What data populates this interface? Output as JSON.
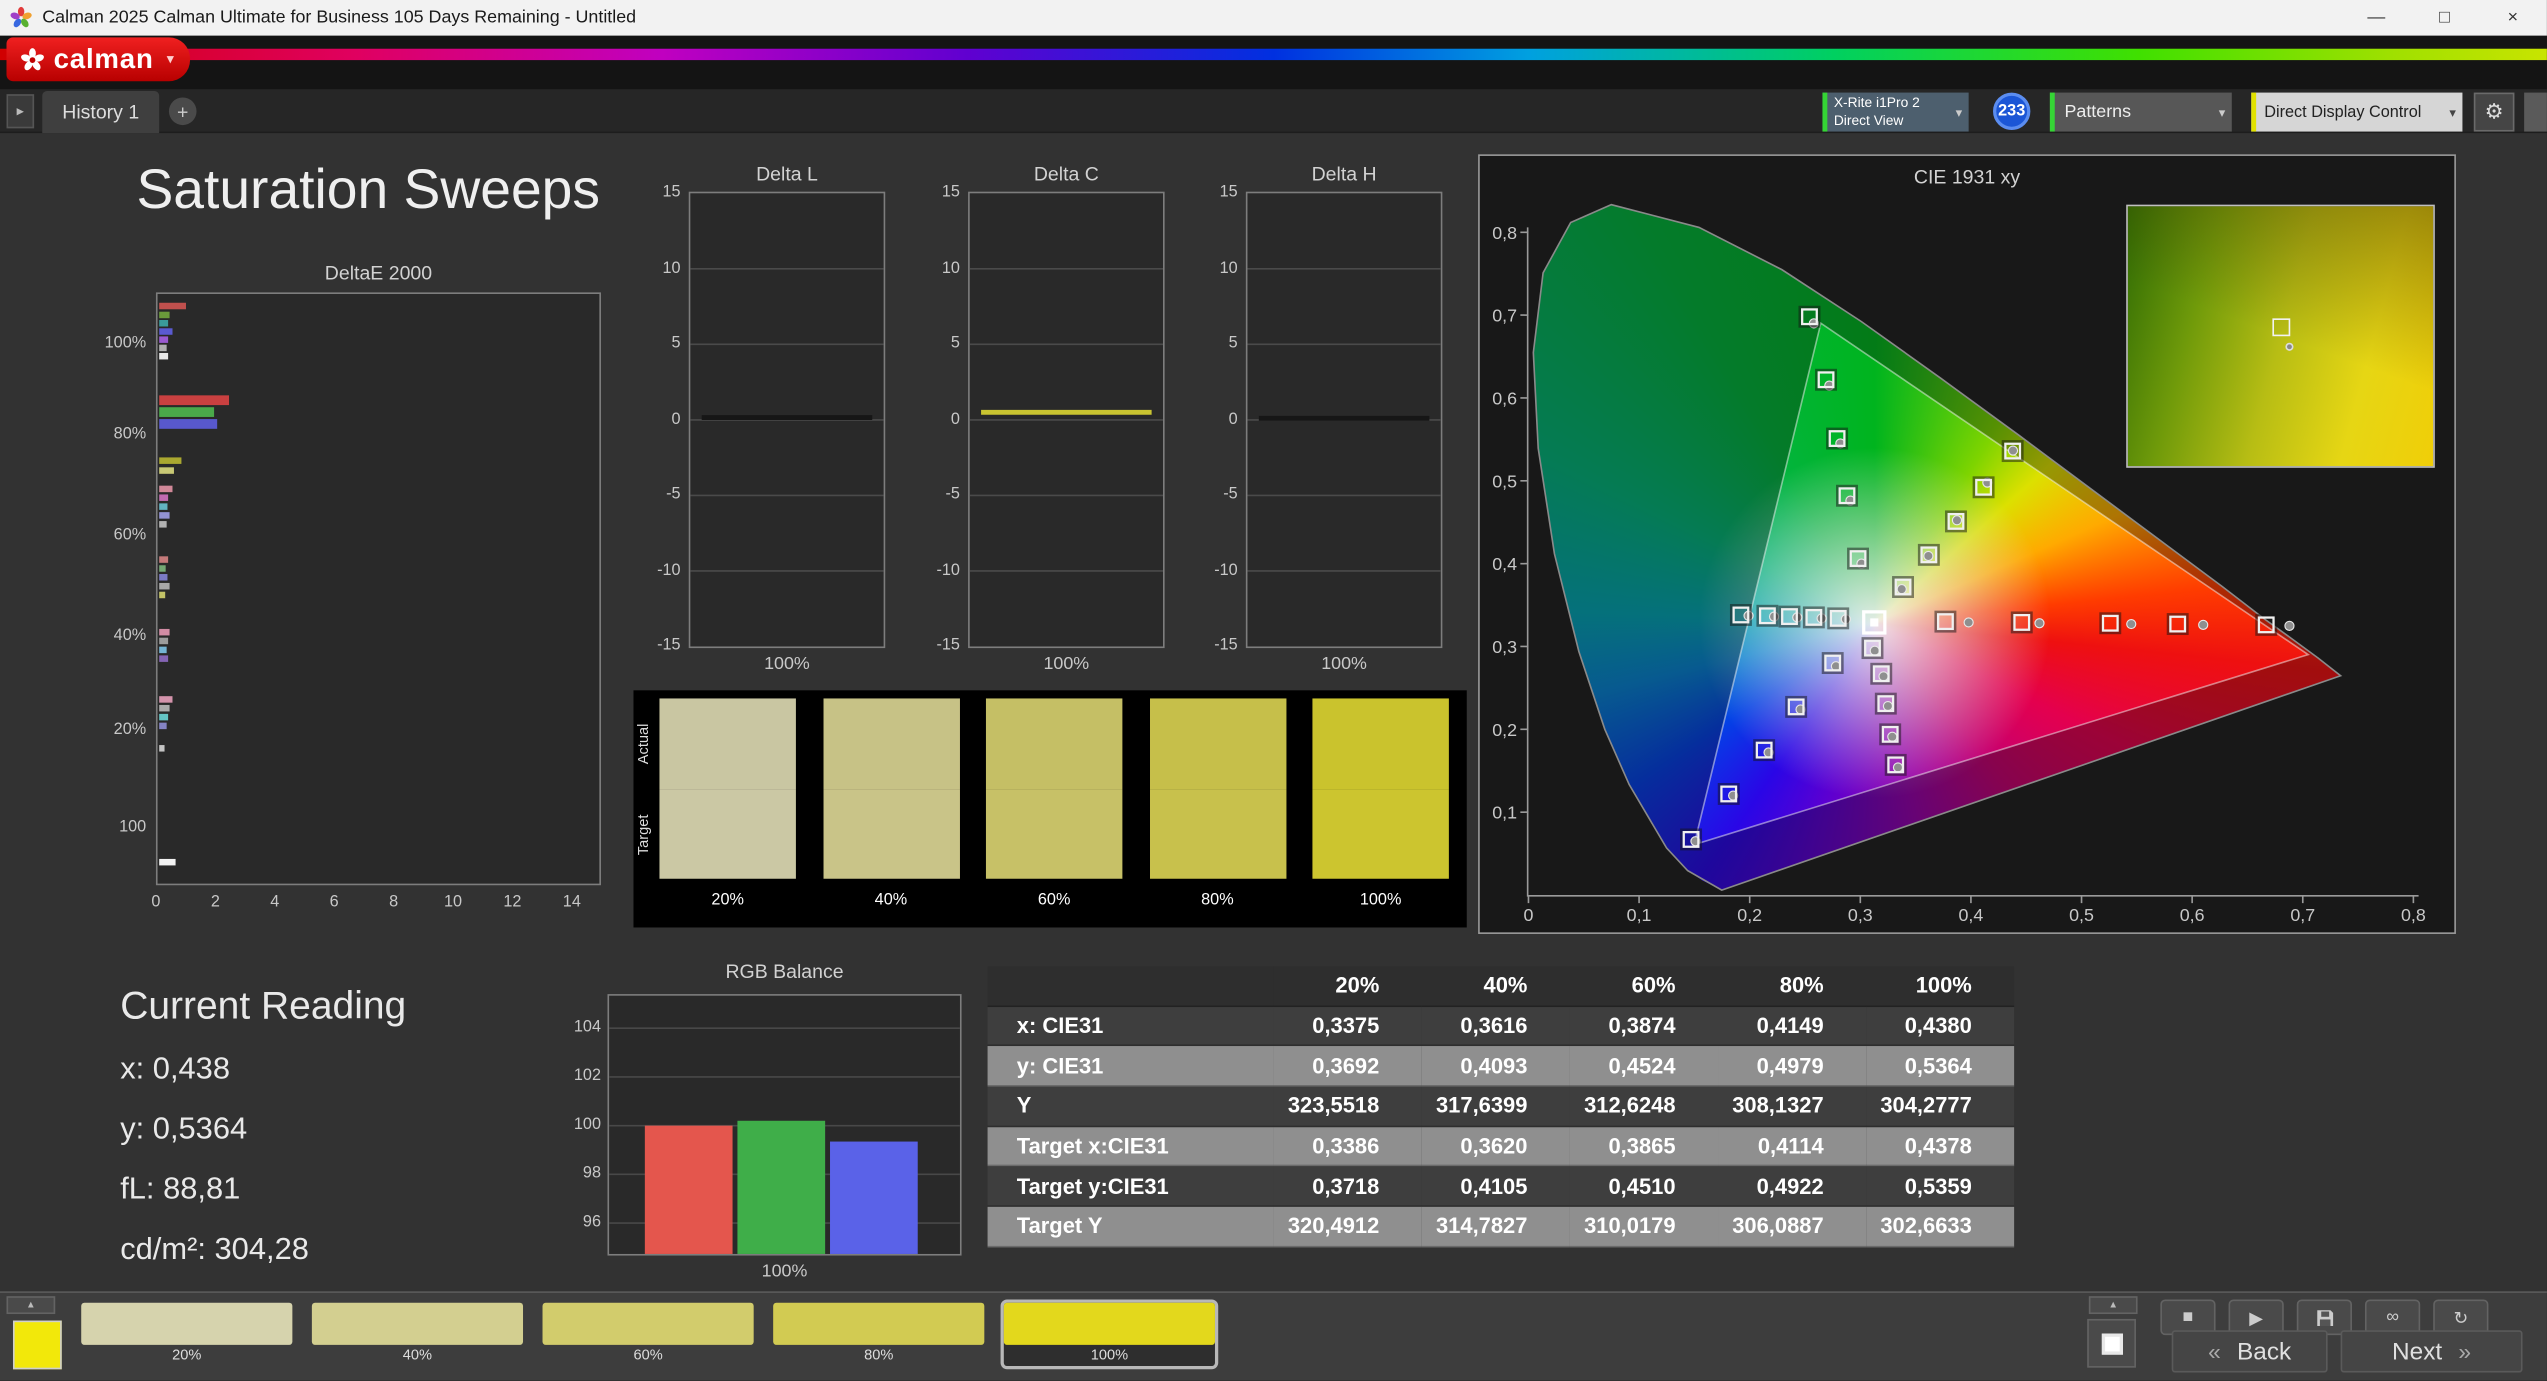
{
  "window": {
    "title": "Calman 2025 Calman Ultimate for Business 105 Days Remaining  - Untitled",
    "controls": {
      "minimize": "—",
      "maximize": "□",
      "close": "×"
    }
  },
  "logo": {
    "text": "calman"
  },
  "icons": {
    "chevron_down": "▾",
    "gear": "⚙",
    "pane_toggle": "▸",
    "up_triangle": "▲"
  },
  "tabbar": {
    "history_tab": "History 1",
    "add_tab": "+"
  },
  "toolbar": {
    "meter": {
      "line1": "X-Rite i1Pro 2",
      "line2": "Direct View"
    },
    "badge": "233",
    "patterns": "Patterns",
    "display_control": "Direct Display Control"
  },
  "page": {
    "title": "Saturation Sweeps"
  },
  "current_reading": {
    "title": "Current Reading",
    "x": "x: 0,438",
    "y": "y: 0,5364",
    "fl": "fL: 88,81",
    "cdm2": "cd/m²: 304,28"
  },
  "table": {
    "columns": [
      "20%",
      "40%",
      "60%",
      "80%",
      "100%"
    ],
    "rows": [
      {
        "label": "x: CIE31",
        "values": [
          "0,3375",
          "0,3616",
          "0,3874",
          "0,4149",
          "0,4380"
        ]
      },
      {
        "label": "y: CIE31",
        "values": [
          "0,3692",
          "0,4093",
          "0,4524",
          "0,4979",
          "0,5364"
        ]
      },
      {
        "label": "Y",
        "values": [
          "323,5518",
          "317,6399",
          "312,6248",
          "308,1327",
          "304,2777"
        ]
      },
      {
        "label": "Target x:CIE31",
        "values": [
          "0,3386",
          "0,3620",
          "0,3865",
          "0,4114",
          "0,4378"
        ]
      },
      {
        "label": "Target y:CIE31",
        "values": [
          "0,3718",
          "0,4105",
          "0,4510",
          "0,4922",
          "0,5359"
        ]
      },
      {
        "label": "Target Y",
        "values": [
          "320,4912",
          "314,7827",
          "310,0179",
          "306,0887",
          "302,6633"
        ]
      }
    ]
  },
  "swatch_strip": {
    "row_labels": [
      "Actual",
      "Target"
    ],
    "swatches": [
      {
        "label": "20%",
        "actual": "#c9c6a2",
        "target": "#cbc8a4"
      },
      {
        "label": "40%",
        "actual": "#c7c286",
        "target": "#c9c488"
      },
      {
        "label": "60%",
        "actual": "#c5bf65",
        "target": "#c7c167"
      },
      {
        "label": "80%",
        "actual": "#c6bf4a",
        "target": "#c8c14c"
      },
      {
        "label": "100%",
        "actual": "#cac32d",
        "target": "#ccc52f"
      }
    ]
  },
  "bottombar": {
    "swatches": [
      {
        "label": "20%",
        "color": "#d6d3ad",
        "selected": false
      },
      {
        "label": "40%",
        "color": "#d3cf90",
        "selected": false
      },
      {
        "label": "60%",
        "color": "#d2cc6c",
        "selected": false
      },
      {
        "label": "80%",
        "color": "#d2cb52",
        "selected": false
      },
      {
        "label": "100%",
        "color": "#e3d81c",
        "selected": true
      }
    ],
    "back": "Back",
    "next": "Next",
    "back_chevron": "«",
    "next_chevron": "»",
    "icons": {
      "stop": "■",
      "play": "▶",
      "infinity": "∞",
      "refresh": "↻"
    }
  },
  "chart_data": [
    {
      "id": "deltae",
      "type": "bar",
      "orientation": "horizontal",
      "title": "DeltaE 2000",
      "xlim": [
        0,
        14
      ],
      "x_ticks": [
        0,
        2,
        4,
        6,
        8,
        10,
        12,
        14
      ],
      "y_labels": [
        {
          "text": "100%",
          "frac": 0.085
        },
        {
          "text": "80%",
          "frac": 0.241
        },
        {
          "text": "60%",
          "frac": 0.411
        },
        {
          "text": "40%",
          "frac": 0.581
        },
        {
          "text": "20%",
          "frac": 0.74
        },
        {
          "text": "100",
          "frac": 0.907
        }
      ],
      "bars": [
        {
          "frac": 0.015,
          "value": 0.9,
          "color": "#c0504d"
        },
        {
          "frac": 0.03,
          "value": 0.35,
          "color": "#6a9a3a"
        },
        {
          "frac": 0.044,
          "value": 0.3,
          "color": "#3a9a9a"
        },
        {
          "frac": 0.058,
          "value": 0.45,
          "color": "#5a5ad0"
        },
        {
          "frac": 0.072,
          "value": 0.3,
          "color": "#9a5ad0"
        },
        {
          "frac": 0.086,
          "value": 0.25,
          "color": "#b0b0b0"
        },
        {
          "frac": 0.1,
          "value": 0.3,
          "color": "#e8e8e8"
        },
        {
          "frac": 0.172,
          "value": 2.35,
          "color": "#c94040",
          "thick": true
        },
        {
          "frac": 0.192,
          "value": 1.85,
          "color": "#4aa84a",
          "thick": true
        },
        {
          "frac": 0.212,
          "value": 1.95,
          "color": "#5858cc",
          "thick": true
        },
        {
          "frac": 0.277,
          "value": 0.75,
          "color": "#aaa830"
        },
        {
          "frac": 0.294,
          "value": 0.5,
          "color": "#c8c874"
        },
        {
          "frac": 0.325,
          "value": 0.45,
          "color": "#d08898"
        },
        {
          "frac": 0.34,
          "value": 0.3,
          "color": "#c06ab0"
        },
        {
          "frac": 0.355,
          "value": 0.28,
          "color": "#62b2c2"
        },
        {
          "frac": 0.37,
          "value": 0.35,
          "color": "#9292d2"
        },
        {
          "frac": 0.385,
          "value": 0.25,
          "color": "#b2b2b2"
        },
        {
          "frac": 0.445,
          "value": 0.3,
          "color": "#c47a7a"
        },
        {
          "frac": 0.46,
          "value": 0.22,
          "color": "#74a874"
        },
        {
          "frac": 0.475,
          "value": 0.28,
          "color": "#7a7ac4"
        },
        {
          "frac": 0.49,
          "value": 0.35,
          "color": "#a8a8a8"
        },
        {
          "frac": 0.505,
          "value": 0.2,
          "color": "#c2c266"
        },
        {
          "frac": 0.568,
          "value": 0.35,
          "color": "#d28ca4"
        },
        {
          "frac": 0.583,
          "value": 0.3,
          "color": "#9c9c9c"
        },
        {
          "frac": 0.598,
          "value": 0.25,
          "color": "#74b4d4"
        },
        {
          "frac": 0.613,
          "value": 0.3,
          "color": "#8464b4"
        },
        {
          "frac": 0.682,
          "value": 0.45,
          "color": "#d494ac"
        },
        {
          "frac": 0.697,
          "value": 0.35,
          "color": "#ababab"
        },
        {
          "frac": 0.712,
          "value": 0.3,
          "color": "#64c4c4"
        },
        {
          "frac": 0.727,
          "value": 0.25,
          "color": "#8484c4"
        },
        {
          "frac": 0.765,
          "value": 0.18,
          "color": "#c4c4c4"
        },
        {
          "frac": 0.958,
          "value": 0.55,
          "color": "#f2f2f2"
        }
      ]
    },
    {
      "id": "delta-l",
      "type": "line",
      "title": "Delta L",
      "ylim": [
        -15,
        15
      ],
      "y_ticks": [
        15,
        10,
        5,
        0,
        -5,
        -10,
        -15
      ],
      "x_label": "100%",
      "value": 0.15,
      "line_color": "#161616"
    },
    {
      "id": "delta-c",
      "type": "line",
      "title": "Delta C",
      "ylim": [
        -15,
        15
      ],
      "y_ticks": [
        15,
        10,
        5,
        0,
        -5,
        -10,
        -15
      ],
      "x_label": "100%",
      "value": 0.5,
      "line_color": "#c9c431"
    },
    {
      "id": "delta-h",
      "type": "line",
      "title": "Delta H",
      "ylim": [
        -15,
        15
      ],
      "y_ticks": [
        15,
        10,
        5,
        0,
        -5,
        -10,
        -15
      ],
      "x_label": "100%",
      "value": 0.1,
      "line_color": "#161616"
    },
    {
      "id": "rgb-balance",
      "type": "bar",
      "title": "RGB Balance",
      "ylim": [
        94.3,
        105.3
      ],
      "y_ticks": [
        104,
        102,
        100,
        98,
        96
      ],
      "x_label": "100%",
      "series": [
        {
          "name": "Red",
          "value": 100.0,
          "color": "#e4564d"
        },
        {
          "name": "Green",
          "value": 100.2,
          "color": "#3fae49"
        },
        {
          "name": "Blue",
          "value": 99.35,
          "color": "#5a62e8"
        }
      ]
    },
    {
      "id": "cie",
      "type": "scatter",
      "title": "CIE 1931 xy",
      "xlim": [
        0,
        0.8
      ],
      "ylim": [
        0,
        0.8
      ],
      "x_ticks": [
        "0",
        "0,1",
        "0,2",
        "0,3",
        "0,4",
        "0,5",
        "0,6",
        "0,7",
        "0,8"
      ],
      "y_ticks": [
        "0",
        "0,1",
        "0,2",
        "0,3",
        "0,4",
        "0,5",
        "0,6",
        "0,7",
        "0,8"
      ],
      "white_point": [
        0.3127,
        0.329
      ],
      "sweeps": [
        {
          "name": "yellow",
          "targets": [
            [
              0.3386,
              0.3718
            ],
            [
              0.362,
              0.4105
            ],
            [
              0.3865,
              0.451
            ],
            [
              0.4114,
              0.4922
            ],
            [
              0.4378,
              0.5359
            ]
          ],
          "measured": [
            [
              0.3375,
              0.3692
            ],
            [
              0.3616,
              0.4093
            ],
            [
              0.3874,
              0.4524
            ],
            [
              0.4149,
              0.4979
            ],
            [
              0.438,
              0.5364
            ]
          ]
        },
        {
          "name": "red",
          "targets": [
            [
              0.377,
              0.33
            ],
            [
              0.446,
              0.329
            ],
            [
              0.526,
              0.328
            ],
            [
              0.587,
              0.327
            ],
            [
              0.667,
              0.326
            ]
          ],
          "measured": [
            [
              0.398,
              0.329
            ],
            [
              0.462,
              0.328
            ],
            [
              0.545,
              0.327
            ],
            [
              0.61,
              0.326
            ],
            [
              0.688,
              0.325
            ]
          ]
        },
        {
          "name": "green",
          "targets": [
            [
              0.298,
              0.406
            ],
            [
              0.288,
              0.482
            ],
            [
              0.279,
              0.551
            ],
            [
              0.269,
              0.622
            ],
            [
              0.254,
              0.698
            ]
          ],
          "measured": [
            [
              0.301,
              0.4
            ],
            [
              0.291,
              0.476
            ],
            [
              0.282,
              0.545
            ],
            [
              0.272,
              0.615
            ],
            [
              0.258,
              0.69
            ]
          ]
        },
        {
          "name": "cyan",
          "targets": [
            [
              0.28,
              0.334
            ],
            [
              0.258,
              0.335
            ],
            [
              0.236,
              0.336
            ],
            [
              0.216,
              0.337
            ],
            [
              0.192,
              0.338
            ]
          ],
          "measured": [
            [
              0.287,
              0.333
            ],
            [
              0.265,
              0.334
            ],
            [
              0.243,
              0.335
            ],
            [
              0.222,
              0.336
            ],
            [
              0.199,
              0.337
            ]
          ]
        },
        {
          "name": "blue",
          "targets": [
            [
              0.275,
              0.28
            ],
            [
              0.242,
              0.227
            ],
            [
              0.213,
              0.175
            ],
            [
              0.181,
              0.122
            ],
            [
              0.147,
              0.067
            ]
          ],
          "measured": [
            [
              0.278,
              0.276
            ],
            [
              0.246,
              0.224
            ],
            [
              0.217,
              0.172
            ],
            [
              0.185,
              0.12
            ],
            [
              0.151,
              0.065
            ]
          ]
        },
        {
          "name": "magenta",
          "targets": [
            [
              0.311,
              0.298
            ],
            [
              0.319,
              0.267
            ],
            [
              0.323,
              0.231
            ],
            [
              0.327,
              0.194
            ],
            [
              0.332,
              0.157
            ]
          ],
          "measured": [
            [
              0.313,
              0.295
            ],
            [
              0.321,
              0.264
            ],
            [
              0.325,
              0.228
            ],
            [
              0.329,
              0.191
            ],
            [
              0.334,
              0.154
            ]
          ]
        }
      ]
    }
  ]
}
